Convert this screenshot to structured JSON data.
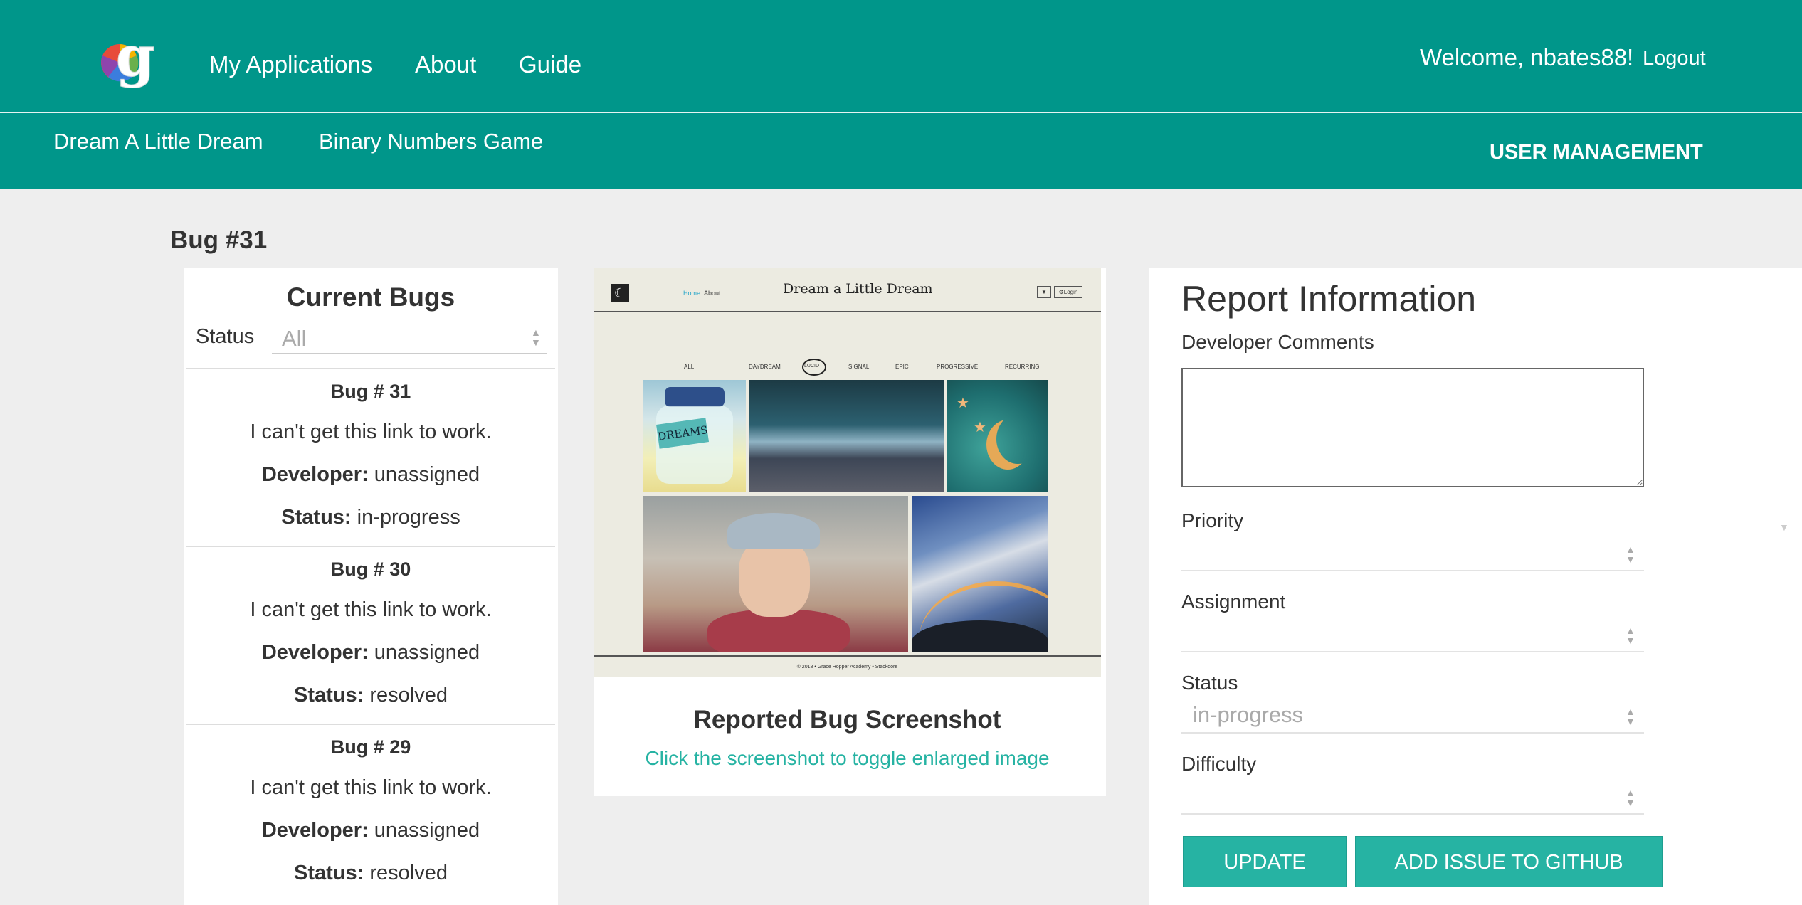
{
  "header": {
    "logo_letter": "g",
    "nav": [
      "My Applications",
      "About",
      "Guide"
    ],
    "welcome": "Welcome, nbates88!",
    "logout": "Logout"
  },
  "subnav": {
    "apps": [
      "Dream A Little Dream",
      "Binary Numbers Game"
    ],
    "user_management": "USER MANAGEMENT"
  },
  "page_title": "Bug #31",
  "bugs_panel": {
    "title": "Current Bugs",
    "filter_label": "Status",
    "filter_value": "All",
    "developer_label": "Developer:",
    "status_label": "Status:",
    "items": [
      {
        "num": "Bug # 31",
        "desc": "I can't get this link to work.",
        "developer": "unassigned",
        "status": "in-progress"
      },
      {
        "num": "Bug # 30",
        "desc": "I can't get this link to work.",
        "developer": "unassigned",
        "status": "resolved"
      },
      {
        "num": "Bug # 29",
        "desc": "I can't get this link to work.",
        "developer": "unassigned",
        "status": "resolved"
      }
    ]
  },
  "screenshot": {
    "site_title": "Dream a Little Dream",
    "mini_nav": [
      "Home",
      "About"
    ],
    "mini_buttons": [
      "▼",
      "⚙Login"
    ],
    "jar_label": "DREAMS",
    "categories": [
      "ALL",
      "DAYDREAM",
      "LUCID",
      "SIGNAL",
      "EPIC",
      "PROGRESSIVE",
      "RECURRING"
    ],
    "footer": "© 2018 • Grace Hopper Academy • Stackdore",
    "title": "Reported Bug Screenshot",
    "link": "Click the screenshot to toggle enlarged image"
  },
  "report": {
    "title": "Report Information",
    "comments_label": "Developer Comments",
    "comments_value": "",
    "priority_label": "Priority",
    "priority_value": "",
    "assignment_label": "Assignment",
    "assignment_value": "",
    "status_label": "Status",
    "status_value": "in-progress",
    "difficulty_label": "Difficulty",
    "difficulty_value": "",
    "update_button": "UPDATE",
    "github_button": "ADD ISSUE TO GITHUB"
  },
  "colors": {
    "brand": "#00968a",
    "accent": "#26b3a3",
    "background": "#eeeeee"
  }
}
